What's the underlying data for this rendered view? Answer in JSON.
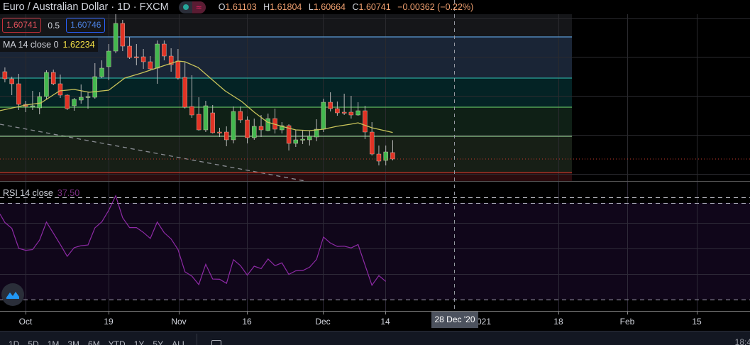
{
  "header": {
    "title": "Euro / Australian Dollar · 1D · FXCM",
    "status_icon": "market-open-dot",
    "wave_icon": "≈",
    "ohlc": {
      "o_label": "O",
      "o": "1.61103",
      "h_label": "H",
      "h": "1.61804",
      "l_label": "L",
      "l": "1.60664",
      "c_label": "C",
      "c": "1.60741",
      "change": "−0.00362 (−0.22%)"
    }
  },
  "quotes": {
    "sell": "1.60741",
    "spread": "0.5",
    "buy": "1.60746"
  },
  "ma_legend": {
    "label": "MA 14 close 0",
    "value": "1.62234"
  },
  "rsi_legend": {
    "label": "RSI 14 close",
    "value": "37.50"
  },
  "time_axis": [
    "Oct",
    "19",
    "Nov",
    "16",
    "Dec",
    "14",
    "021",
    "18",
    "Feb",
    "15"
  ],
  "crosshair_label": "28 Dec '20",
  "toolbar": {
    "ranges": [
      "1D",
      "5D",
      "1M",
      "3M",
      "6M",
      "YTD",
      "1Y",
      "5Y",
      "ALL"
    ],
    "clock": "18:4"
  },
  "colors": {
    "up": "#43b84f",
    "down": "#e03325",
    "ma": "#c9c45a",
    "rsi": "#8e2aa6",
    "band_top": "#1a2536",
    "band_2": "#042325",
    "band_3": "#0f2016",
    "band_4": "#171f16",
    "band_low": "#2a0b0e"
  },
  "chart_data": [
    {
      "type": "candlestick",
      "title": "Euro / Australian Dollar · 1D · FXCM",
      "ohlc": [
        [
          1.6566,
          1.659,
          1.6506,
          1.6526
        ],
        [
          1.6526,
          1.6538,
          1.6434,
          1.6498
        ],
        [
          1.6498,
          1.6554,
          1.635,
          1.6382
        ],
        [
          1.6382,
          1.6402,
          1.6338,
          1.637
        ],
        [
          1.637,
          1.6458,
          1.635,
          1.6374
        ],
        [
          1.6362,
          1.645,
          1.6326,
          1.6426
        ],
        [
          1.6426,
          1.6574,
          1.641,
          1.6562
        ],
        [
          1.6562,
          1.6578,
          1.649,
          1.6498
        ],
        [
          1.6498,
          1.655,
          1.6418,
          1.6434
        ],
        [
          1.6434,
          1.6438,
          1.635,
          1.6358
        ],
        [
          1.6374,
          1.6418,
          1.6346,
          1.641
        ],
        [
          1.6406,
          1.6494,
          1.6386,
          1.6422
        ],
        [
          1.6422,
          1.6454,
          1.6358,
          1.6426
        ],
        [
          1.6422,
          1.6614,
          1.6414,
          1.6538
        ],
        [
          1.6538,
          1.663,
          1.653,
          1.6586
        ],
        [
          1.6594,
          1.6722,
          1.6518,
          1.6682
        ],
        [
          1.6682,
          1.689,
          1.667,
          1.6838
        ],
        [
          1.6838,
          1.6858,
          1.6682,
          1.671
        ],
        [
          1.671,
          1.6762,
          1.6638,
          1.6646
        ],
        [
          1.665,
          1.6722,
          1.6602,
          1.6646
        ],
        [
          1.665,
          1.6694,
          1.6582,
          1.6622
        ],
        [
          1.6622,
          1.6654,
          1.6578,
          1.6582
        ],
        [
          1.6586,
          1.6742,
          1.6498,
          1.6722
        ],
        [
          1.6722,
          1.6742,
          1.663,
          1.6654
        ],
        [
          1.6654,
          1.6698,
          1.6566,
          1.6606
        ],
        [
          1.6626,
          1.6694,
          1.6522,
          1.653
        ],
        [
          1.6534,
          1.6618,
          1.6358,
          1.6366
        ],
        [
          1.637,
          1.6546,
          1.6306,
          1.6322
        ],
        [
          1.6326,
          1.6422,
          1.6234,
          1.6238
        ],
        [
          1.6238,
          1.6402,
          1.6226,
          1.6374
        ],
        [
          1.6334,
          1.6378,
          1.6218,
          1.6222
        ],
        [
          1.6226,
          1.625,
          1.6198,
          1.6222
        ],
        [
          1.6226,
          1.6258,
          1.6146,
          1.6182
        ],
        [
          1.6182,
          1.637,
          1.6162,
          1.6342
        ],
        [
          1.6342,
          1.637,
          1.6278,
          1.6294
        ],
        [
          1.6294,
          1.6314,
          1.6162,
          1.6194
        ],
        [
          1.6194,
          1.6302,
          1.6182,
          1.6258
        ],
        [
          1.6258,
          1.6322,
          1.6198,
          1.6238
        ],
        [
          1.6234,
          1.633,
          1.623,
          1.6302
        ],
        [
          1.6302,
          1.6358,
          1.6218,
          1.6242
        ],
        [
          1.6238,
          1.6282,
          1.6218,
          1.6262
        ],
        [
          1.6262,
          1.627,
          1.6122,
          1.6162
        ],
        [
          1.6162,
          1.6238,
          1.6142,
          1.6182
        ],
        [
          1.6182,
          1.6238,
          1.6158,
          1.6186
        ],
        [
          1.6182,
          1.6234,
          1.615,
          1.6202
        ],
        [
          1.6198,
          1.6298,
          1.6174,
          1.6242
        ],
        [
          1.6242,
          1.6414,
          1.6226,
          1.6394
        ],
        [
          1.6394,
          1.645,
          1.6342,
          1.6358
        ],
        [
          1.6358,
          1.6398,
          1.6318,
          1.6334
        ],
        [
          1.6338,
          1.6442,
          1.6322,
          1.6334
        ],
        [
          1.6338,
          1.643,
          1.6302,
          1.6322
        ],
        [
          1.6322,
          1.6394,
          1.6318,
          1.6346
        ],
        [
          1.6346,
          1.6374,
          1.6186,
          1.6226
        ],
        [
          1.6226,
          1.6282,
          1.6094,
          1.6102
        ],
        [
          1.6102,
          1.615,
          1.6038,
          1.6062
        ],
        [
          1.6066,
          1.615,
          1.6038,
          1.6114
        ],
        [
          1.61103,
          1.61804,
          1.60664,
          1.60741
        ]
      ],
      "ma14": [
        [
          -0.7,
          1.6338
        ],
        [
          4,
          1.6378
        ],
        [
          6.2,
          1.639
        ],
        [
          8.9,
          1.6458
        ],
        [
          11,
          1.6466
        ],
        [
          13.2,
          1.645
        ],
        [
          16,
          1.6462
        ],
        [
          18.3,
          1.653
        ],
        [
          20.7,
          1.6558
        ],
        [
          23.8,
          1.6598
        ],
        [
          26,
          1.6626
        ],
        [
          27,
          1.6622
        ],
        [
          28.9,
          1.659
        ],
        [
          30.9,
          1.6522
        ],
        [
          32.8,
          1.6458
        ],
        [
          35.2,
          1.6398
        ],
        [
          37,
          1.6338
        ],
        [
          38.9,
          1.6282
        ],
        [
          41,
          1.6258
        ],
        [
          43,
          1.6238
        ],
        [
          45,
          1.6234
        ],
        [
          47,
          1.6242
        ],
        [
          48.9,
          1.6258
        ],
        [
          50.9,
          1.627
        ],
        [
          52,
          1.6278
        ],
        [
          54,
          1.625
        ],
        [
          57,
          1.62234
        ]
      ],
      "levels": [
        1.6762,
        1.653,
        1.6366,
        1.6202,
        1.5998
      ],
      "last_close": 1.60741
    },
    {
      "type": "line",
      "title": "RSI 14 close",
      "ylim": [
        0,
        100
      ],
      "bands": [
        30,
        70
      ],
      "values": [
        61.9,
        59.5,
        51.2,
        50.4,
        50.7,
        54.6,
        62.1,
        57.5,
        52.8,
        47.9,
        51.5,
        52.3,
        52.6,
        59.7,
        62.2,
        67.0,
        73.0,
        63.9,
        59.8,
        59.8,
        57.8,
        55.3,
        62.1,
        57.7,
        55.1,
        50.7,
        41.5,
        39.7,
        36.2,
        44.6,
        38.5,
        38.4,
        36.7,
        46.5,
        44.1,
        40.1,
        43.8,
        42.8,
        46.8,
        44.0,
        45.2,
        40.4,
        41.9,
        42.0,
        43.4,
        46.6,
        55.9,
        53.4,
        52.0,
        52.1,
        51.4,
        52.8,
        44.3,
        35.9,
        39.9,
        37.5
      ]
    }
  ]
}
